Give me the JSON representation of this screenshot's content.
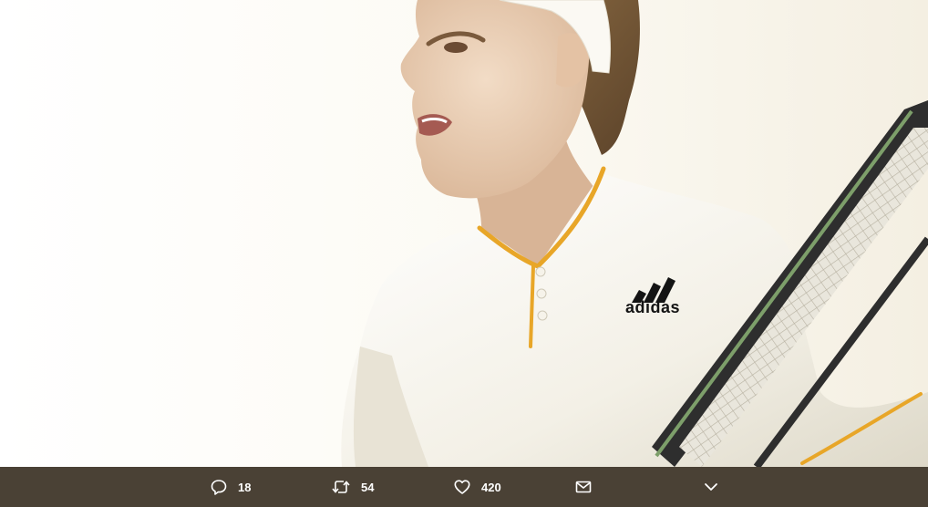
{
  "photo": {
    "brand_text": "adidas"
  },
  "actions": {
    "reply": {
      "icon": "reply-icon",
      "count": "18"
    },
    "retweet": {
      "icon": "retweet-icon",
      "count": "54"
    },
    "like": {
      "icon": "heart-icon",
      "count": "420"
    },
    "message": {
      "icon": "envelope-icon"
    },
    "more": {
      "icon": "chevron-down-icon"
    }
  },
  "colors": {
    "action_bar_bg": "#4a4135",
    "icon_color": "#ffffff",
    "collar_accent": "#e8a628"
  }
}
